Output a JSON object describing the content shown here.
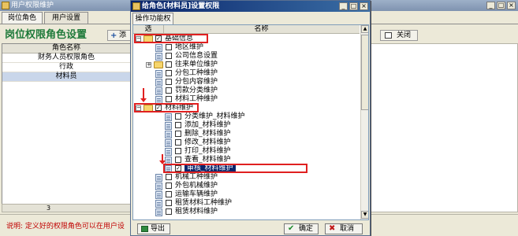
{
  "background_window": {
    "title": "用户权限维护",
    "tabs": [
      "岗位角色",
      "用户设置"
    ],
    "heading": "岗位权限角色设置",
    "toolbar_add": "添",
    "close_button": "关闭",
    "grid_header": "角色名称",
    "grid_rows": [
      "财务人员权限角色",
      "行政",
      "材料员"
    ],
    "row_count": "3",
    "note": "说明: 定义好的权限角色可以在用户设"
  },
  "dialog": {
    "title": "给角色[材料员]设置权限",
    "tab": "操作功能权限",
    "col_select": "选",
    "col_name": "名称",
    "tree": [
      {
        "label": "基础信息",
        "level": 0,
        "type": "folder",
        "expander": "−",
        "checked": true
      },
      {
        "label": "地区维护",
        "level": 1,
        "type": "doc",
        "checked": false
      },
      {
        "label": "公司信息设置",
        "level": 1,
        "type": "doc",
        "checked": false
      },
      {
        "label": "往来单位维护",
        "level": 1,
        "type": "folder",
        "expander": "+",
        "checked": false
      },
      {
        "label": "分包工种维护",
        "level": 1,
        "type": "doc",
        "checked": false
      },
      {
        "label": "分包内容维护",
        "level": 1,
        "type": "doc",
        "checked": false
      },
      {
        "label": "罚款分类维护",
        "level": 1,
        "type": "doc",
        "checked": false
      },
      {
        "label": "材料工种维护",
        "level": 1,
        "type": "doc",
        "checked": false
      },
      {
        "label": "材料维护",
        "level": 0,
        "type": "folder",
        "expander": "−",
        "checked": true
      },
      {
        "label": "分类维护_材料维护",
        "level": 2,
        "type": "doc",
        "checked": false
      },
      {
        "label": "添加_材料维护",
        "level": 2,
        "type": "doc",
        "checked": false
      },
      {
        "label": "删除_材料维护",
        "level": 2,
        "type": "doc",
        "checked": false
      },
      {
        "label": "修改_材料维护",
        "level": 2,
        "type": "doc",
        "checked": false
      },
      {
        "label": "打印_材料维护",
        "level": 2,
        "type": "doc",
        "checked": false
      },
      {
        "label": "查看_材料维护",
        "level": 2,
        "type": "doc",
        "checked": false
      },
      {
        "label": "审核_材料维护",
        "level": 2,
        "type": "doc",
        "checked": true,
        "selected": true
      },
      {
        "label": "机械工种维护",
        "level": 1,
        "type": "doc",
        "checked": false
      },
      {
        "label": "外包机械维护",
        "level": 1,
        "type": "doc",
        "checked": false
      },
      {
        "label": "运输车辆维护",
        "level": 1,
        "type": "doc",
        "checked": false
      },
      {
        "label": "租赁材料工种维护",
        "level": 1,
        "type": "doc",
        "checked": false
      },
      {
        "label": "租赁材料维护",
        "level": 1,
        "type": "doc",
        "checked": false
      }
    ],
    "export_button": "导出",
    "ok_button": "确定",
    "cancel_button": "取消"
  },
  "colors": {
    "heading": "#1f7a3a",
    "selection": "#0a246a",
    "highlight": "#e02020",
    "note": "#c00000"
  }
}
